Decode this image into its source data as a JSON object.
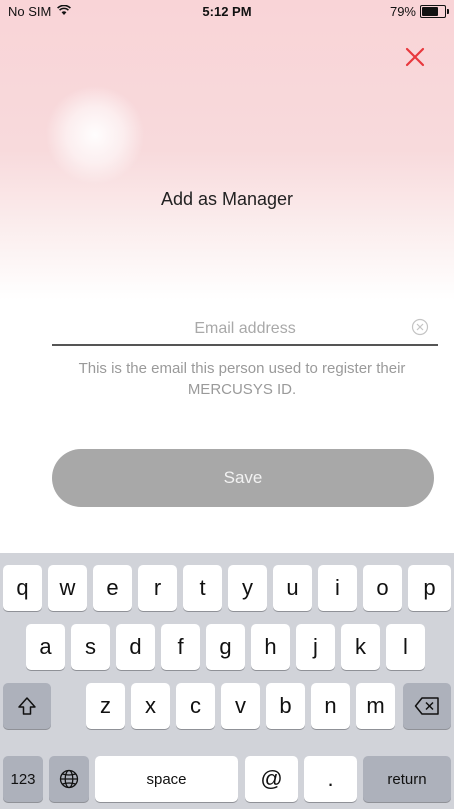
{
  "status_bar": {
    "carrier": "No SIM",
    "time": "5:12 PM",
    "battery": "79%",
    "battery_level": 0.79
  },
  "header": {
    "title": "Add as Manager"
  },
  "form": {
    "email_placeholder": "Email address",
    "email_value": "",
    "hint": "This is the email this person used to register their MERCUSYS ID."
  },
  "actions": {
    "save_label": "Save"
  },
  "keyboard": {
    "row1": [
      "q",
      "w",
      "e",
      "r",
      "t",
      "y",
      "u",
      "i",
      "o",
      "p"
    ],
    "row2": [
      "a",
      "s",
      "d",
      "f",
      "g",
      "h",
      "j",
      "k",
      "l"
    ],
    "row3": [
      "z",
      "x",
      "c",
      "v",
      "b",
      "n",
      "m"
    ],
    "numbers_label": "123",
    "space_label": "space",
    "at_label": "@",
    "dot_label": ".",
    "return_label": "return"
  },
  "colors": {
    "accent": "#e8383d",
    "button_disabled": "#a8a8a8",
    "keyboard_bg": "#d1d3d9"
  }
}
